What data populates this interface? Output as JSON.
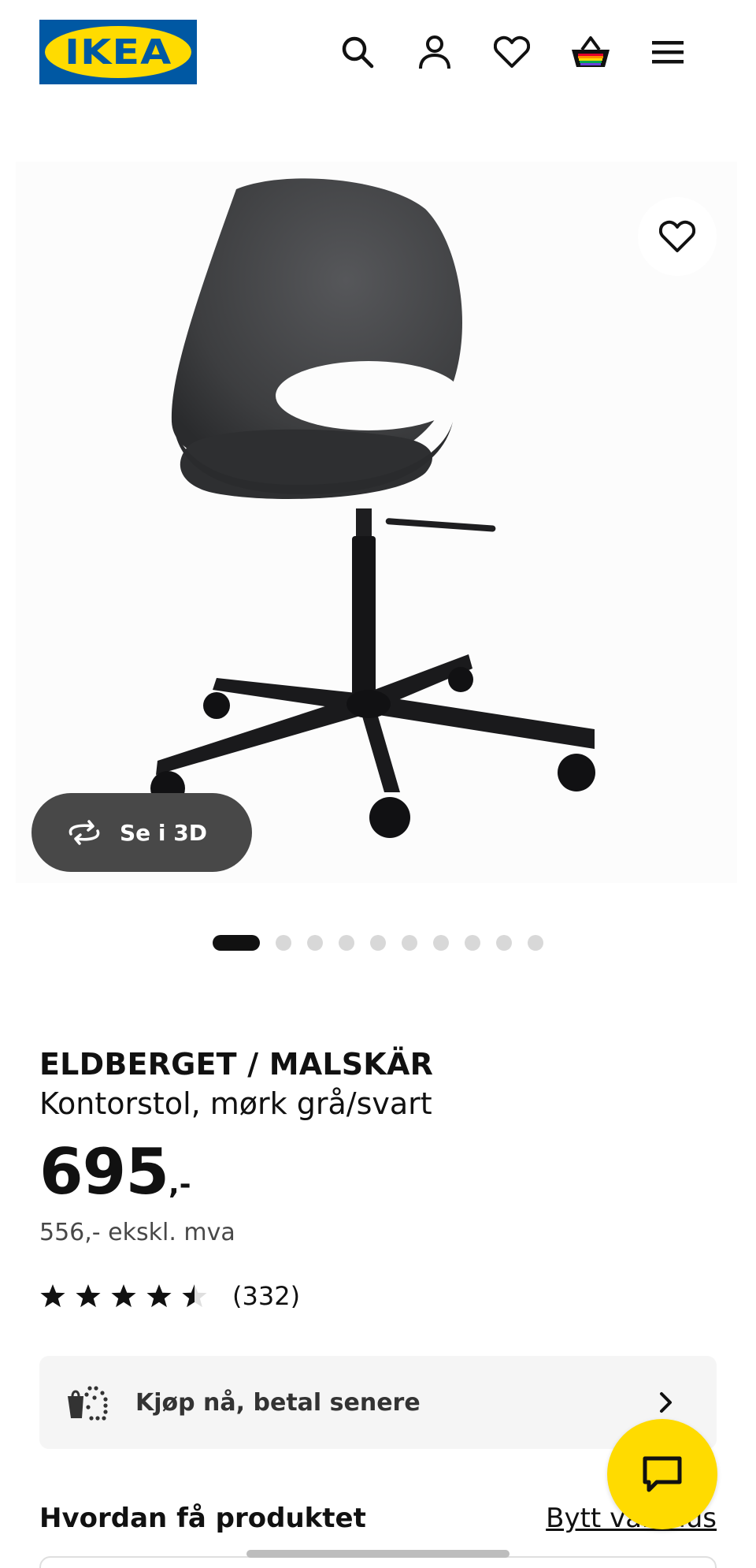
{
  "header": {
    "logo_text": "IKEA",
    "icons": [
      "search-icon",
      "user-icon",
      "heart-icon",
      "basket-icon",
      "menu-icon"
    ],
    "brand_blue": "#0058a3",
    "brand_yellow": "#ffdb00"
  },
  "gallery": {
    "view_3d_label": "Se i 3D",
    "image_count": 10,
    "active_index": 1
  },
  "product": {
    "name": "ELDBERGET / MALSKÄR",
    "description": "Kontorstol, mørk grå/svart",
    "price": "695",
    "price_suffix": ",-",
    "price_ex_vat": "556,- ekskl. mva",
    "rating_value": 4.5,
    "rating_count": "(332)"
  },
  "payment": {
    "label": "Kjøp nå, betal senere"
  },
  "delivery": {
    "title": "Hvordan få produktet",
    "change_store_link": "Bytt varehus"
  }
}
